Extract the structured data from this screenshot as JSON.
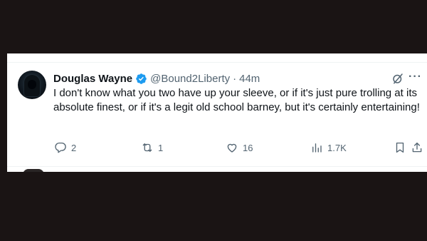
{
  "tweet": {
    "author_name": "Douglas Wayne",
    "handle": "@Bound2Liberty",
    "separator": "·",
    "time": "44m",
    "text": "I don't know what you two have up your sleeve, or if it's just pure trolling at its absolute finest, or if it's a legit old school barney, but it's certainly entertaining!",
    "more_label": "···"
  },
  "actions": {
    "replies": "2",
    "reposts": "1",
    "likes": "16",
    "views": "1.7K"
  },
  "colors": {
    "verified": "#1d9bf0",
    "secondary_text": "#536471",
    "primary_text": "#0f1419",
    "letterbox": "#1a1414"
  },
  "icons": [
    "verified-badge-icon",
    "grok-icon",
    "more-icon",
    "reply-icon",
    "repost-icon",
    "like-icon",
    "views-icon",
    "bookmark-icon",
    "share-icon"
  ]
}
